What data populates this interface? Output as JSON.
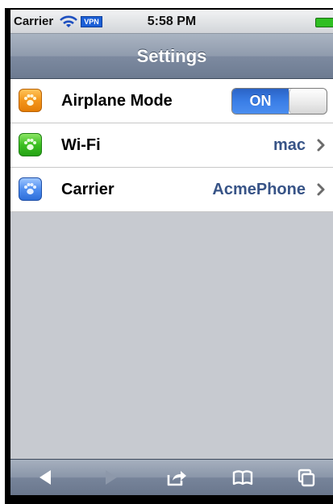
{
  "status_bar": {
    "carrier": "Carrier",
    "vpn": "VPN",
    "time": "5:58 PM"
  },
  "nav": {
    "title": "Settings"
  },
  "settings": {
    "rows": [
      {
        "label": "Airplane Mode",
        "icon": "orange-paw-icon",
        "control": "toggle",
        "toggle_text": "ON"
      },
      {
        "label": "Wi-Fi",
        "icon": "green-paw-icon",
        "value": "mac"
      },
      {
        "label": "Carrier",
        "icon": "blue-paw-icon",
        "value": "AcmePhone"
      }
    ]
  },
  "toolbar": {
    "buttons": [
      "back-icon",
      "forward-icon",
      "share-icon",
      "bookmarks-icon",
      "tabs-icon"
    ]
  },
  "colors": {
    "accent_blue": "#3a7ee6",
    "value_text": "#385487",
    "nav_gradient_top": "#aab4c2",
    "nav_gradient_bottom": "#6d7b91"
  }
}
